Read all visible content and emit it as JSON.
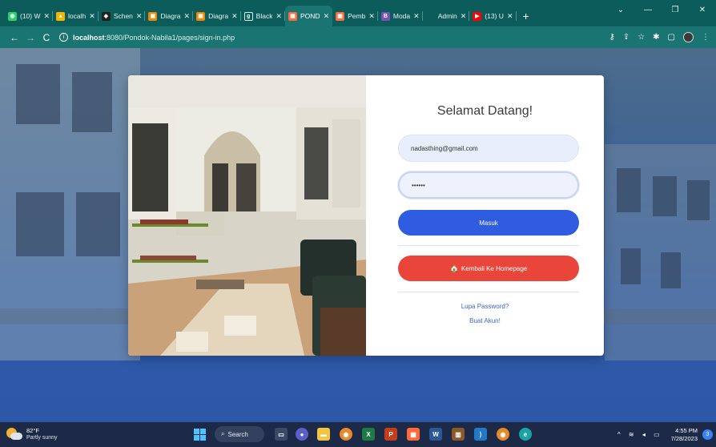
{
  "browser": {
    "tabs": [
      {
        "title": "(10) W",
        "fav_glyph": "◉",
        "fav_color": "#25d366"
      },
      {
        "title": "localh",
        "fav_glyph": "▲",
        "fav_color": "#f7b500"
      },
      {
        "title": "Schen",
        "fav_glyph": "◈",
        "fav_color": "#222222"
      },
      {
        "title": "Diagra",
        "fav_glyph": "▣",
        "fav_color": "#f08705"
      },
      {
        "title": "Diagra",
        "fav_glyph": "▣",
        "fav_color": "#f08705"
      },
      {
        "title": "Black",
        "fav_glyph": "g",
        "fav_color": "#0b5c5a"
      },
      {
        "title": "POND",
        "fav_glyph": "▦",
        "fav_color": "#ff6a3d",
        "active": true
      },
      {
        "title": "Pemb",
        "fav_glyph": "▦",
        "fav_color": "#ff6a3d"
      },
      {
        "title": "Moda",
        "fav_glyph": "B",
        "fav_color": "#7952b3"
      },
      {
        "title": "Admin",
        "fav_glyph": "",
        "fav_color": "#0b5c5a"
      },
      {
        "title": "(13) U",
        "fav_glyph": "▶",
        "fav_color": "#ff0000"
      }
    ],
    "new_tab": "+",
    "url_host": "localhost",
    "url_path": ":8080/Pondok-Nabila1/pages/sign-in.php"
  },
  "login": {
    "heading": "Selamat Datang!",
    "email_value": "nadasthing@gmail.com",
    "password_value": "••••••",
    "submit_label": "Masuk",
    "home_label": "Kembali Ke Homepage",
    "forgot_label": "Lupa Password?",
    "register_label": "Buat Akun!",
    "colors": {
      "primary": "#2f5ce0",
      "danger": "#e9453a"
    }
  },
  "taskbar": {
    "temperature": "82°F",
    "weather": "Partly sunny",
    "search_label": "Search",
    "time": "4:55 PM",
    "date": "7/28/2023",
    "notifications": "3"
  }
}
